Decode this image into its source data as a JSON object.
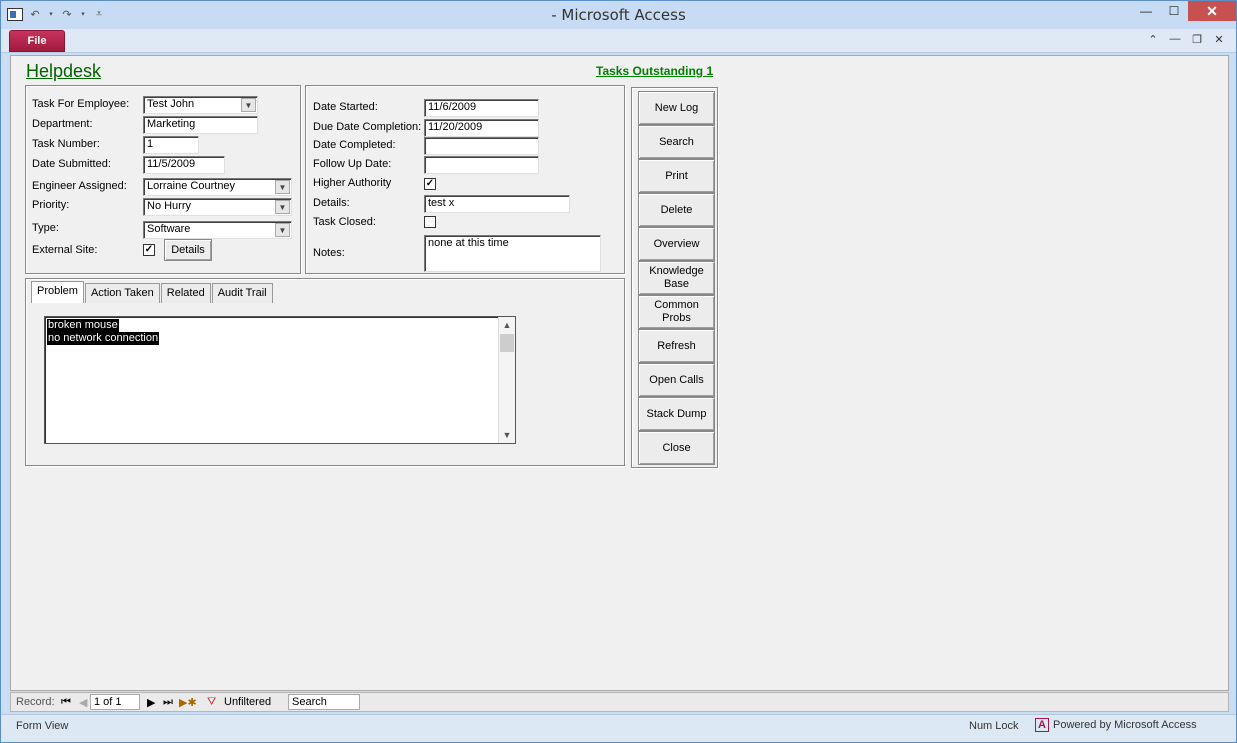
{
  "window": {
    "title": "- Microsoft Access",
    "file_tab": "File"
  },
  "form": {
    "title": "Helpdesk",
    "tasks_outstanding": "Tasks Outstanding 1"
  },
  "left_fields": {
    "employee": {
      "label": "Task For Employee:",
      "value": "Test John"
    },
    "department": {
      "label": "Department:",
      "value": "Marketing"
    },
    "task_number": {
      "label": "Task Number:",
      "value": "1"
    },
    "date_submitted": {
      "label": "Date Submitted:",
      "value": "11/5/2009"
    },
    "engineer": {
      "label": "Engineer Assigned:",
      "value": "Lorraine Courtney"
    },
    "priority": {
      "label": "Priority:",
      "value": "No Hurry"
    },
    "type": {
      "label": "Type:",
      "value": "Software"
    },
    "external_site": {
      "label": "External Site:",
      "checked": true
    },
    "details_button": "Details"
  },
  "right_fields": {
    "date_started": {
      "label": "Date Started:",
      "value": "11/6/2009"
    },
    "due_date": {
      "label": "Due Date Completion:",
      "value": "11/20/2009"
    },
    "date_completed": {
      "label": "Date Completed:",
      "value": ""
    },
    "follow_up": {
      "label": "Follow Up Date:",
      "value": ""
    },
    "higher_authority": {
      "label": "Higher Authority",
      "checked": true
    },
    "details": {
      "label": "Details:",
      "value": "test x"
    },
    "task_closed": {
      "label": "Task Closed:",
      "checked": false
    },
    "notes": {
      "label": "Notes:",
      "value": "none at this time"
    }
  },
  "tabs": [
    {
      "label": "Problem",
      "active": true
    },
    {
      "label": "Action Taken",
      "active": false
    },
    {
      "label": "Related",
      "active": false
    },
    {
      "label": "Audit Trail",
      "active": false
    }
  ],
  "problem_text": [
    "broken mouse",
    "no network connection"
  ],
  "side_buttons": {
    "new_log": "New Log",
    "search": "Search",
    "print": "Print",
    "delete": "Delete",
    "overview": "Overview",
    "knowledge_base_1": "Knowledge",
    "knowledge_base_2": "Base",
    "common_probs_1": "Common",
    "common_probs_2": "Probs",
    "refresh": "Refresh",
    "open_calls": "Open Calls",
    "stack_dump": "Stack Dump",
    "close": "Close"
  },
  "record_nav": {
    "label": "Record:",
    "position": "1 of 1",
    "filter": "Unfiltered",
    "search": "Search"
  },
  "status_bar": {
    "view": "Form View",
    "num_lock": "Num Lock",
    "powered_by": "Powered by Microsoft Access"
  }
}
